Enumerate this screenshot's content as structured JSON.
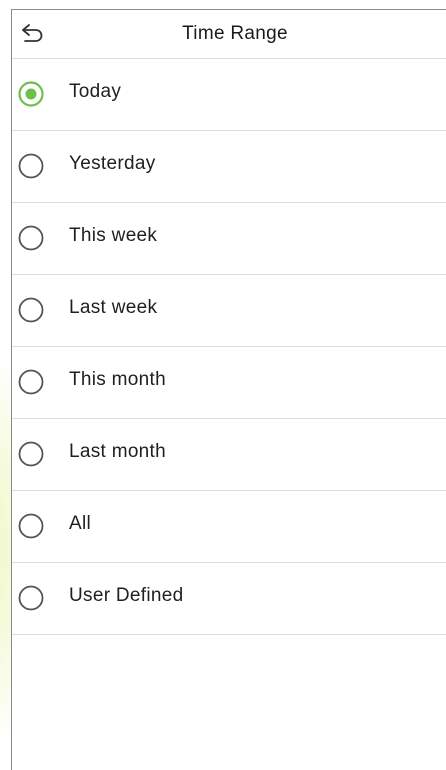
{
  "header": {
    "title": "Time Range",
    "back_icon": "back-arrow-icon"
  },
  "accent_color": "#6cc04a",
  "options": [
    {
      "label": "Today",
      "selected": true
    },
    {
      "label": "Yesterday",
      "selected": false
    },
    {
      "label": "This week",
      "selected": false
    },
    {
      "label": "Last week",
      "selected": false
    },
    {
      "label": "This month",
      "selected": false
    },
    {
      "label": "Last month",
      "selected": false
    },
    {
      "label": "All",
      "selected": false
    },
    {
      "label": "User Defined",
      "selected": false
    }
  ]
}
